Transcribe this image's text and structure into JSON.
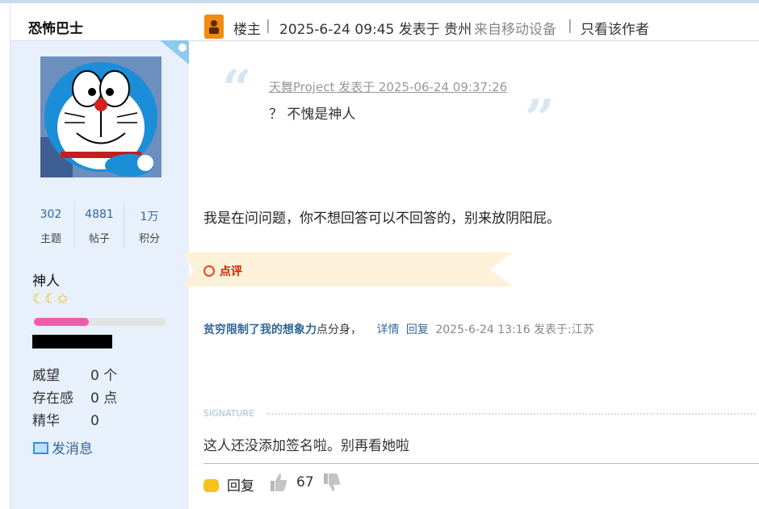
{
  "sidebar": {
    "username": "恐怖巴士",
    "stats": [
      {
        "value": "302",
        "label": "主题"
      },
      {
        "value": "4881",
        "label": "帖子"
      },
      {
        "value": "1万",
        "label": "积分"
      }
    ],
    "rank_title": "神人",
    "rank_stars": "☾☾✩",
    "level_progress": 0.42,
    "attributes": [
      {
        "key": "威望",
        "value": "0 个"
      },
      {
        "key": "存在感",
        "value": "0 点"
      },
      {
        "key": "精华",
        "value": "0"
      }
    ],
    "send_message": "发消息"
  },
  "post_header": {
    "owner_label": "楼主",
    "sep": "|",
    "datetime": "2025-6-24 09:45 发表于 贵州",
    "device": "来自移动设备",
    "sep2": "|",
    "only_author": "只看该作者"
  },
  "quote": {
    "source": "天舞Project 发表于 2025-06-24 09:37:26",
    "text": "？ 不愧是神人"
  },
  "body_text": "我是在问问题，你不想回答可以不回答的，别来放阴阳屁。",
  "comment_label": "点评",
  "reply": {
    "author": "贫穷限制了我的想象力",
    "action": "点分身，",
    "detail": "详情",
    "reply": "回复",
    "meta": "2025-6-24 13:16 发表于:江苏"
  },
  "signature": {
    "label": "SIGNATURE",
    "text": "这人还没添加签名啦。别再看她啦"
  },
  "footer": {
    "reply": "回复",
    "likes": "67"
  },
  "colors": {
    "sidebar_bg": "#e8f1fb",
    "link": "#336699",
    "owner_badge": "#f08c12",
    "ribbon": "#fdf1d9",
    "progress": "#ef5daa"
  }
}
